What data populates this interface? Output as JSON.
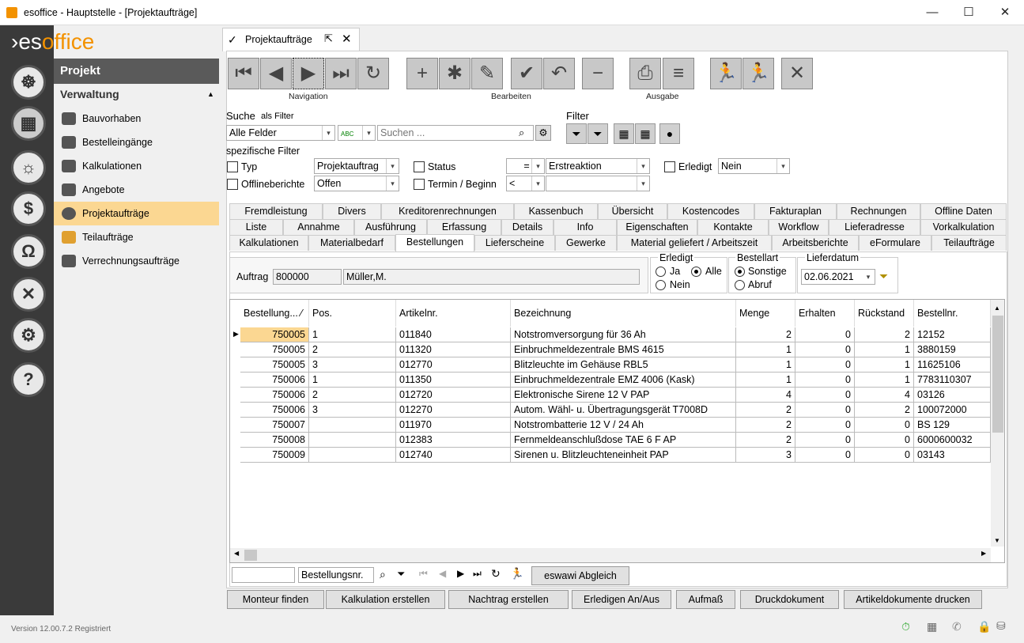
{
  "window": {
    "title": "esoffice - Hauptstelle - [Projektaufträge]",
    "minimize": "—",
    "maximize": "☐",
    "close": "✕"
  },
  "logo": {
    "a": "es",
    "b": "office"
  },
  "sidebar": {
    "header": "Projekt",
    "section": "Verwaltung",
    "items": [
      {
        "label": "Bauvorhaben",
        "icon": "construction-icon"
      },
      {
        "label": "Bestelleingänge",
        "icon": "cart-icon"
      },
      {
        "label": "Kalkulationen",
        "icon": "calculator-icon"
      },
      {
        "label": "Angebote",
        "icon": "offer-icon"
      },
      {
        "label": "Projektaufträge",
        "icon": "check-circle-icon"
      },
      {
        "label": "Teilaufträge",
        "icon": "parts-icon"
      },
      {
        "label": "Verrechnungsaufträge",
        "icon": "billing-icon"
      }
    ]
  },
  "version": "Version 12.00.7.2     Registriert",
  "doc_tab": {
    "label": "Projektaufträge"
  },
  "toolbar": {
    "nav_label": "Navigation",
    "edit_label": "Bearbeiten",
    "out_label": "Ausgabe"
  },
  "search": {
    "label": "Suche",
    "as_filter": "als Filter",
    "field": "Alle Felder",
    "placeholder": "Suchen ...",
    "filter_label": "Filter"
  },
  "specific": {
    "label": "spezifische Filter",
    "typ_label": "Typ",
    "typ_value": "Projektauftrag",
    "status_label": "Status",
    "status_op": "=",
    "status_value": "Erstreaktion",
    "erledigt_label": "Erledigt",
    "erledigt_value": "Nein",
    "offline_label": "Offlineberichte",
    "offline_value": "Offen",
    "termin_label": "Termin / Beginn",
    "termin_op": "<",
    "termin_value": ""
  },
  "tabs_row1": [
    "Fremdleistung",
    "Divers",
    "Kreditorenrechnungen",
    "Kassenbuch",
    "Übersicht",
    "Kostencodes",
    "Fakturaplan",
    "Rechnungen",
    "Offline Daten"
  ],
  "tabs_row2": [
    "Liste",
    "Annahme",
    "Ausführung",
    "Erfassung",
    "Details",
    "Info",
    "Eigenschaften",
    "Kontakte",
    "Workflow",
    "Lieferadresse",
    "Vorkalkulation"
  ],
  "tabs_row3": [
    "Kalkulationen",
    "Materialbedarf",
    "Bestellungen",
    "Lieferscheine",
    "Gewerke",
    "Material geliefert / Arbeitszeit",
    "Arbeitsberichte",
    "eFormulare",
    "Teilaufträge"
  ],
  "order": {
    "label": "Auftrag",
    "number": "800000",
    "name": "Müller,M."
  },
  "erledigt": {
    "label": "Erledigt",
    "ja": "Ja",
    "alle": "Alle",
    "nein": "Nein"
  },
  "bestellart": {
    "label": "Bestellart",
    "sonstige": "Sonstige",
    "abruf": "Abruf"
  },
  "lieferdatum": {
    "label": "Lieferdatum",
    "value": "02.06.2021"
  },
  "grid": {
    "headers": [
      "Bestellung... ⁄",
      "Pos.",
      "Artikelnr.",
      "Bezeichnung",
      "Menge",
      "Erhalten",
      "Rückstand",
      "Bestellnr."
    ],
    "rows": [
      [
        "750005",
        "1",
        "011840",
        "Notstromversorgung für 36 Ah",
        "2",
        "0",
        "2",
        "12152"
      ],
      [
        "750005",
        "2",
        "011320",
        "Einbruchmeldezentrale BMS 4615",
        "1",
        "0",
        "1",
        "3880159"
      ],
      [
        "750005",
        "3",
        "012770",
        "Blitzleuchte im Gehäuse RBL5",
        "1",
        "0",
        "1",
        "11625106"
      ],
      [
        "750006",
        "1",
        "011350",
        "Einbruchmeldezentrale EMZ 4006 (Kask)",
        "1",
        "0",
        "1",
        "7783110307"
      ],
      [
        "750006",
        "2",
        "012720",
        "Elektronische Sirene 12 V PAP",
        "4",
        "0",
        "4",
        "03126"
      ],
      [
        "750006",
        "3",
        "012270",
        "Autom. Wähl- u. Übertragungsgerät T7008D",
        "2",
        "0",
        "2",
        "100072000"
      ],
      [
        "750007",
        "",
        "011970",
        "Notstrombatterie 12 V / 24 Ah",
        "2",
        "0",
        "0",
        "BS 129"
      ],
      [
        "750008",
        "",
        "012383",
        "Fernmeldeanschlußdose TAE 6 F AP",
        "2",
        "0",
        "0",
        "6000600032"
      ],
      [
        "750009",
        "",
        "012740",
        "Sirenen u. Blitzleuchteneinheit PAP",
        "3",
        "0",
        "0",
        "03143"
      ]
    ]
  },
  "gridbar": {
    "search_value": "",
    "field": "Bestellungsnr.",
    "abgleich": "eswawi Abgleich"
  },
  "bottom_buttons": [
    "Monteur finden",
    "Kalkulation erstellen",
    "Nachtrag erstellen",
    "Erledigen An/Aus",
    "Aufmaß",
    "Druckdokument",
    "Artikeldokumente drucken"
  ]
}
